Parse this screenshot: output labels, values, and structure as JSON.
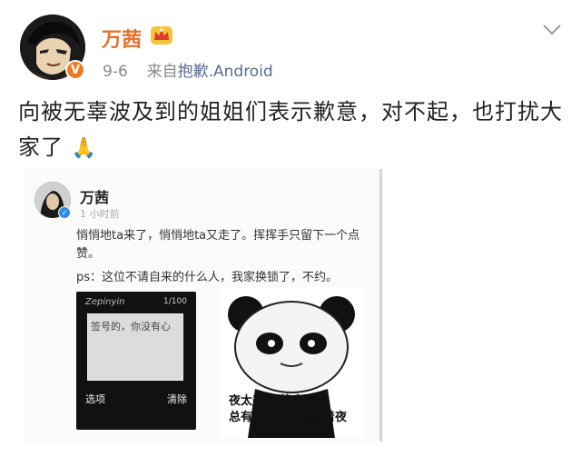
{
  "post": {
    "username": "万茜",
    "date": "9-6",
    "source_prefix": "来自",
    "source_link": "抱歉.Android",
    "text": "向被无辜波及到的姐姐们表示歉意，对不起，也打扰大家了",
    "emoji": "🙏",
    "verified_badge": "V",
    "icons": [
      "avatar",
      "crown-icon",
      "chevron-down-icon",
      "praying-hands-icon"
    ]
  },
  "embedded": {
    "username": "万茜",
    "time": "1 小时前",
    "text": "悄悄地ta来了，悄悄地ta又走了。挥挥手只留下一个点赞。",
    "ps": "ps：这位不请自来的什么人，我家换锁了，不约。",
    "phone": {
      "brand": "Zepinyin",
      "indicator": "1/100",
      "message": "签号的，你没有心",
      "left_softkey": "选项",
      "right_softkey": "清除"
    },
    "meme_caption_line1": "夜太美 尽管太危险",
    "meme_caption_line2": "总有人黑着眼眶熬着夜"
  }
}
